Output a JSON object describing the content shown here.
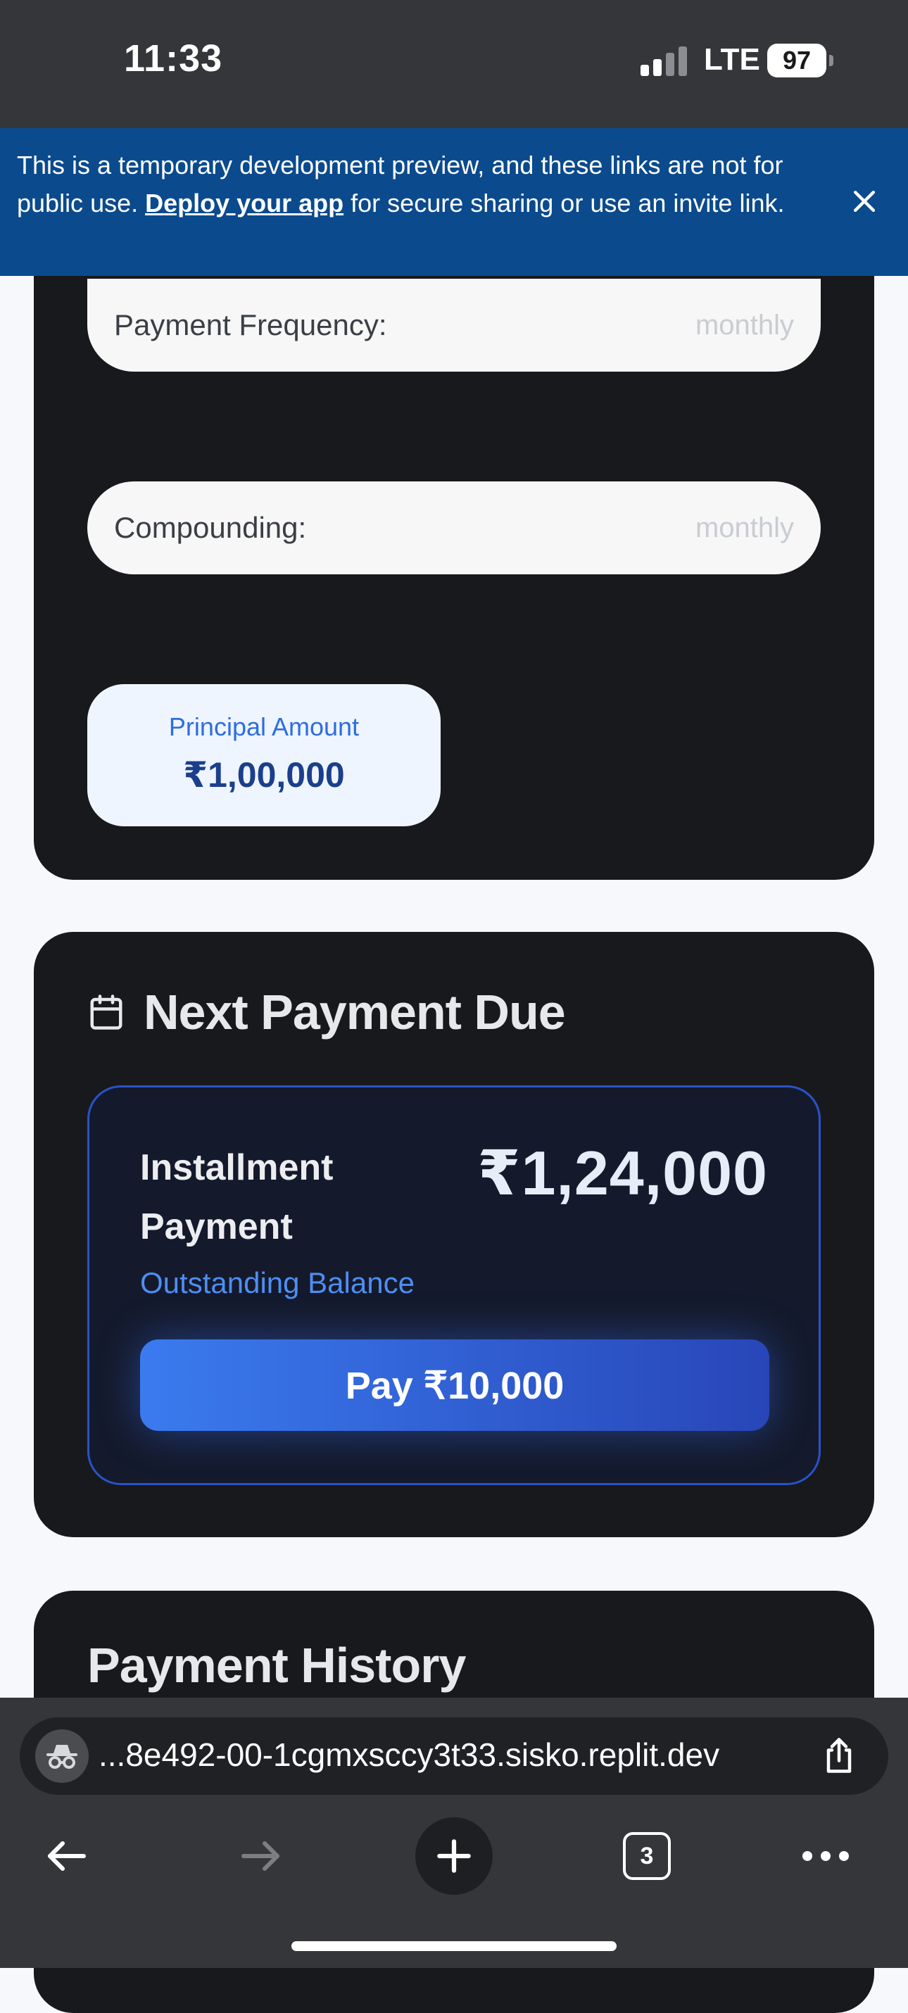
{
  "status_bar": {
    "time": "11:33",
    "network": "LTE",
    "battery": "97"
  },
  "banner": {
    "text_before": "This is a temporary development preview, and these links are not for public use. ",
    "link_text": "Deploy your app",
    "text_after": " for secure sharing or use an invite link."
  },
  "loan_details": {
    "payment_frequency_label": "Payment Frequency:",
    "payment_frequency_value": "monthly",
    "compounding_label": "Compounding:",
    "compounding_value": "monthly",
    "principal_label": "Principal Amount",
    "principal_value": "₹1,00,000"
  },
  "next_payment": {
    "title": "Next Payment Due",
    "installment_label": "Installment Payment",
    "amount": "₹1,24,000",
    "subtitle": "Outstanding Balance",
    "pay_button": "Pay ₹10,000"
  },
  "payment_history": {
    "title": "Payment History"
  },
  "browser": {
    "url": "...8e492-00-1cgmxsccy3t33.sisko.replit.dev",
    "tab_count": "3"
  },
  "colors": {
    "accent": "#3a7bef",
    "banner": "#0b4a8d",
    "card": "#18191c",
    "chrome": "#343639"
  }
}
